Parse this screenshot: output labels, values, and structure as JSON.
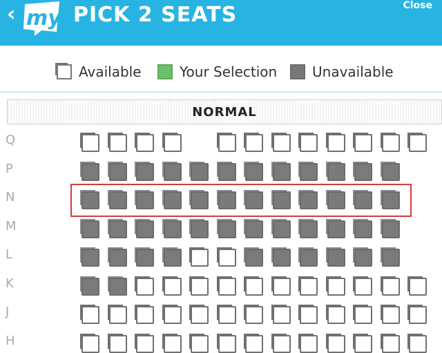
{
  "header": {
    "back_icon": "chevron-left-icon",
    "logo_text": "my",
    "title": "PICK 2 SEATS",
    "close_label": "Close",
    "background": "#28b4e3"
  },
  "legend": [
    {
      "label": "Available",
      "type": "available"
    },
    {
      "label": "Your Selection",
      "type": "selection",
      "color": "#6cc16d"
    },
    {
      "label": "Unavailable",
      "type": "unavailable",
      "color": "#777777"
    }
  ],
  "section": {
    "label": "NORMAL"
  },
  "rows": [
    {
      "label": "Q",
      "seats": "AAAA-AAAAAAAAA"
    },
    {
      "label": "P",
      "seats": "UUUUUUUUUUUU"
    },
    {
      "label": "N",
      "seats": "UUUUUUUUUUUU"
    },
    {
      "label": "M",
      "seats": "UUUUUUUUUUUU"
    },
    {
      "label": "L",
      "seats": "UUUUAAUUUUUU"
    },
    {
      "label": "K",
      "seats": "UUAAAAAAAAAAAA"
    },
    {
      "label": "J",
      "seats": "AAAAAAAAAAAAAA"
    },
    {
      "label": "H",
      "seats": "AAAAAAAAAAAAAA"
    }
  ],
  "highlighted_row": "N"
}
